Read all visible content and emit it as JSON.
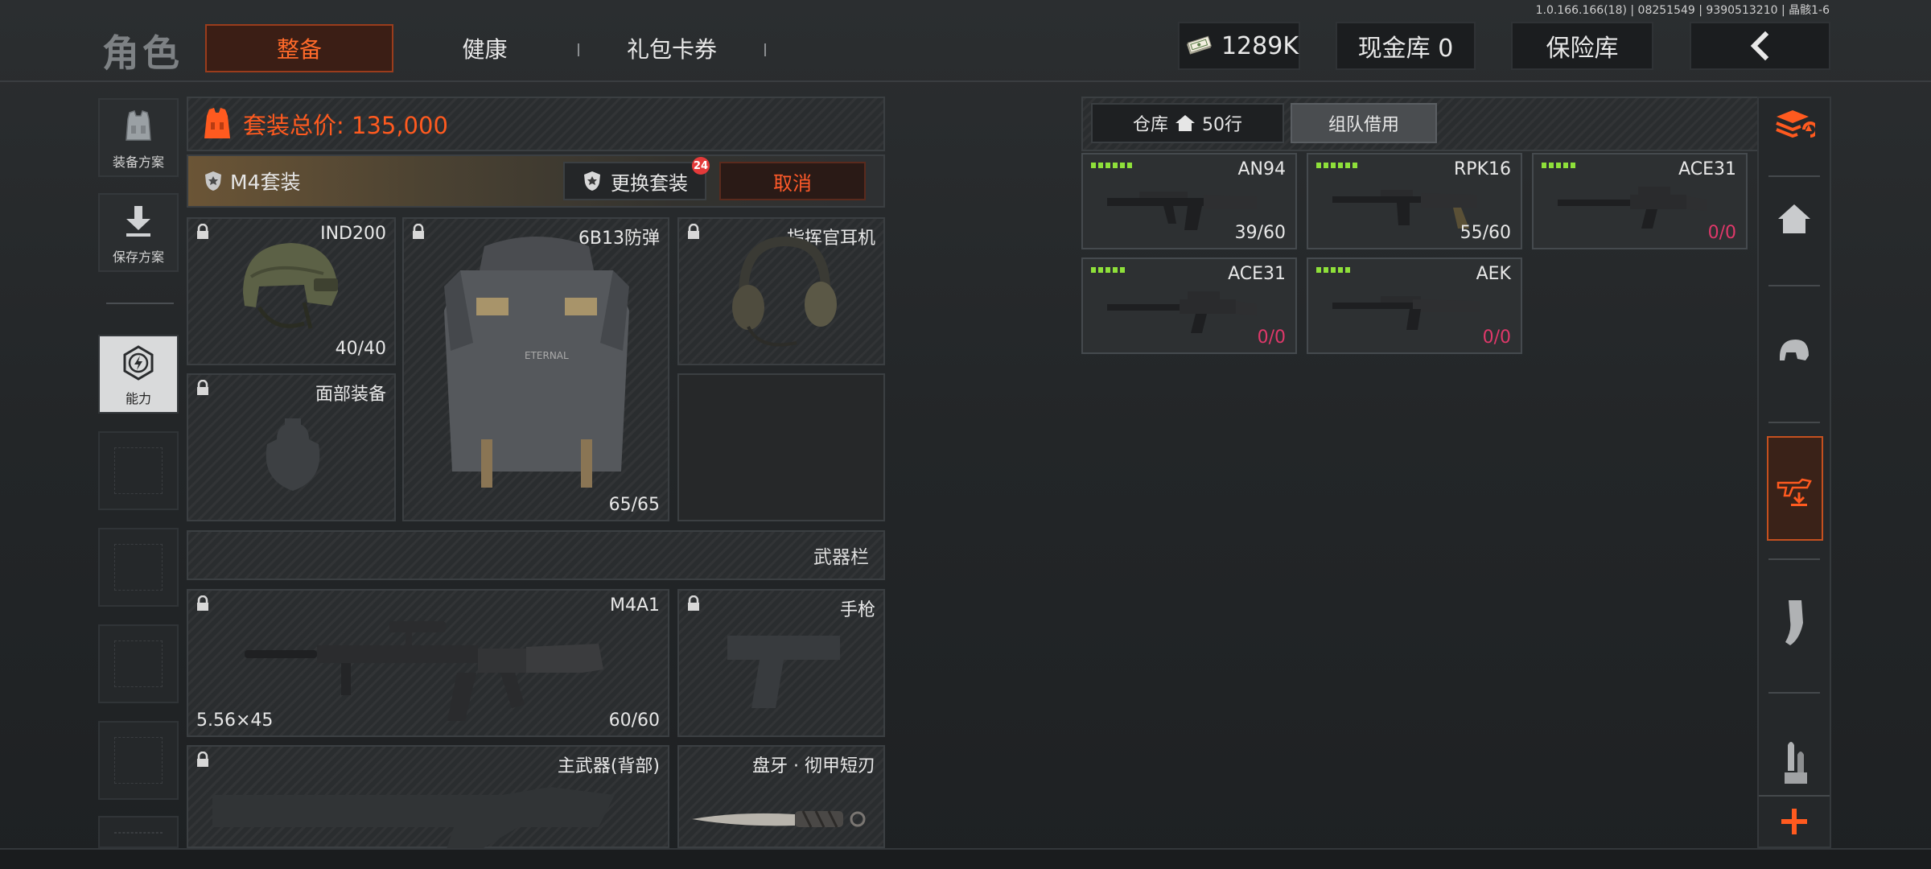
{
  "version": "1.0.166.166(18) | 08251549 | 9390513210 | 晶骸1-6",
  "header": {
    "title": "角色",
    "tabs": [
      {
        "label": "整备",
        "active": true
      },
      {
        "label": "健康",
        "active": false
      },
      {
        "label": "礼包卡券",
        "active": false
      }
    ],
    "money": "1289K",
    "cash_vault": "现金库 0",
    "insurance": "保险库"
  },
  "sidebar": {
    "items": [
      {
        "label": "装备方案",
        "icon": "vest-icon"
      },
      {
        "label": "保存方案",
        "icon": "save-arrow-icon"
      },
      {
        "label": "能力",
        "icon": "ability-icon"
      }
    ]
  },
  "loadout": {
    "total_price_label": "套装总价: 135,000",
    "suit_name": "M4套装",
    "swap_label": "更换套装",
    "swap_badge": "24",
    "cancel_label": "取消",
    "slots": {
      "helmet": {
        "name": "IND200",
        "count": "40/40"
      },
      "armor": {
        "name": "6B13防弹",
        "count": "65/65"
      },
      "headset": {
        "name": "指挥官耳机"
      },
      "face": {
        "name": "面部装备"
      },
      "primary": {
        "name": "M4A1",
        "ammo": "5.56×45",
        "count": "60/60"
      },
      "pistol": {
        "name": "手枪"
      },
      "back_primary": {
        "name": "主武器(背部)"
      },
      "melee": {
        "name": "盘牙 · 彻甲短刃"
      }
    },
    "weapons_header": "武器栏"
  },
  "warehouse": {
    "storage_tab": "仓库",
    "storage_rows": "50行",
    "team_tab": "组队借用",
    "items": [
      {
        "name": "AN94",
        "count_a": "39",
        "count_b": "/60",
        "zero": false,
        "pips": 6
      },
      {
        "name": "RPK16",
        "count_a": "55",
        "count_b": "/60",
        "zero": false,
        "pips": 6
      },
      {
        "name": "ACE31",
        "count_a": "0",
        "count_b": "/0",
        "zero": true,
        "pips": 5
      },
      {
        "name": "ACE31",
        "count_a": "0",
        "count_b": "/0",
        "zero": true,
        "pips": 5
      },
      {
        "name": "AEK",
        "count_a": "0",
        "count_b": "/0",
        "zero": true,
        "pips": 5
      }
    ]
  },
  "right_sidebar": {
    "icons": [
      "stack-refresh-icon",
      "home-icon",
      "helmet-icon",
      "weapon-drop-icon",
      "magazine-icon",
      "ammo-icon",
      "plus-icon"
    ]
  },
  "colors": {
    "accent": "#ff5a1f",
    "pip_green": "#8ee03a",
    "zero_red": "#e0386a"
  }
}
